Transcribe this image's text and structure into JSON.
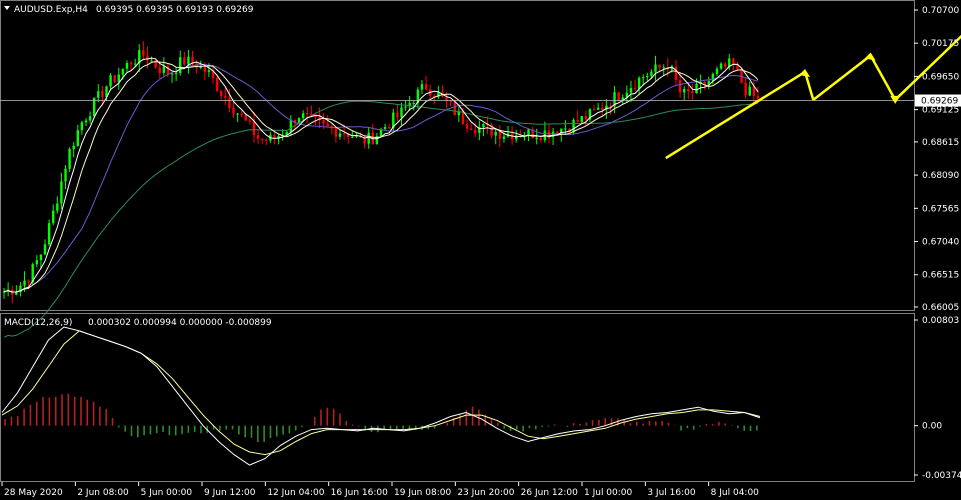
{
  "header": {
    "symbol": "AUDUSD.Exp,H4",
    "ohlc": "0.69395 0.69395 0.69193 0.69269"
  },
  "macd_header": {
    "label": "MACD(12,26,9)",
    "values": "0.000302 0.000994 0.000000 -0.000899"
  },
  "colors": {
    "background": "#000000",
    "bull_candle": "#00ff00",
    "bear_candle": "#ff0000",
    "ma_fast": "#ffffff",
    "ma_mid": "#fffacd",
    "ma_slow": "#6a5acd",
    "ma_long": "#2e8b57",
    "arrows": "#ffff00",
    "macd_line": "#ffffff",
    "signal_line": "#ffff99",
    "hist_pos": "#b22222",
    "hist_neg": "#2e8b2e",
    "price_line": "#c0c0c0"
  },
  "chart_data": [
    {
      "type": "candlestick",
      "title": "AUDUSD.Exp,H4",
      "ylim": [
        0.66005,
        0.707
      ],
      "y_ticks": [
        "0.70700",
        "0.70175",
        "0.69650",
        "0.69125",
        "0.68615",
        "0.68090",
        "0.67565",
        "0.67040",
        "0.66515",
        "0.66005"
      ],
      "current_price": "0.69269",
      "x_ticks": [
        "28 May 2020",
        "2 Jun 08:00",
        "5 Jun 00:00",
        "9 Jun 12:00",
        "12 Jun 04:00",
        "16 Jun 16:00",
        "19 Jun 08:00",
        "23 Jun 20:00",
        "26 Jun 12:00",
        "1 Jul 00:00",
        "3 Jul 16:00",
        "8 Jul 04:00"
      ],
      "trend_points": [
        0.6625,
        0.663,
        0.665,
        0.669,
        0.676,
        0.684,
        0.689,
        0.692,
        0.695,
        0.697,
        0.699,
        0.7,
        0.698,
        0.697,
        0.699,
        0.6985,
        0.697,
        0.694,
        0.6915,
        0.689,
        0.6865,
        0.6865,
        0.688,
        0.6905,
        0.6895,
        0.6885,
        0.688,
        0.6875,
        0.6862,
        0.687,
        0.689,
        0.6905,
        0.693,
        0.695,
        0.6935,
        0.6915,
        0.6895,
        0.6885,
        0.688,
        0.6875,
        0.6875,
        0.6875,
        0.6875,
        0.688,
        0.6885,
        0.6895,
        0.6905,
        0.692,
        0.6935,
        0.695,
        0.6965,
        0.6975,
        0.6985,
        0.6935,
        0.694,
        0.6955,
        0.6975,
        0.6985,
        0.6945,
        0.6927
      ]
    },
    {
      "type": "macd",
      "title": "MACD(12,26,9)",
      "ylim": [
        -0.003749,
        0.00803
      ],
      "y_ticks": [
        "0.00803",
        "0.00",
        "-0.003749"
      ],
      "histogram": [
        0.0005,
        0.0008,
        0.0016,
        0.0022,
        0.0023,
        0.0024,
        0.0021,
        0.0017,
        0.0012,
        -0.0003,
        -0.0009,
        -0.0008,
        -0.0006,
        -0.0006,
        -0.0007,
        -0.0006,
        -0.0004,
        -0.0003,
        -0.0004,
        -0.0009,
        -0.0012,
        -0.001,
        -0.0007,
        -0.0003,
        0.0002,
        0.0016,
        0.0011,
        0.0003,
        -0.0002,
        -0.0005,
        -0.0004,
        -0.0003,
        -0.0003,
        -0.0002,
        -0.0001,
        0.0004,
        0.0012,
        0.0014,
        0.0006,
        -0.0001,
        -0.0004,
        -0.0003,
        -0.0001,
        0.0001,
        -0.0001,
        0.0002,
        0.0004,
        0.0005,
        0.0005,
        0.0003,
        0.0002,
        0.0003,
        0.0002,
        -0.0003,
        -0.0002,
        0.0001,
        0.0002,
        0.0001,
        -0.0003,
        -0.0004
      ],
      "macd": [
        0.001,
        0.0025,
        0.0045,
        0.0065,
        0.0075,
        0.0072,
        0.0068,
        0.0064,
        0.006,
        0.0055,
        0.0045,
        0.003,
        0.0015,
        0.0,
        -0.0012,
        -0.0022,
        -0.003,
        -0.0025,
        -0.0015,
        -0.0008,
        -0.0003,
        -0.0002,
        -0.0003,
        -0.0004,
        -0.0002,
        -0.0003,
        -0.0004,
        -0.0002,
        0.0002,
        0.0007,
        0.001,
        0.0005,
        -0.0002,
        -0.0008,
        -0.0012,
        -0.0009,
        -0.0006,
        -0.0004,
        -0.0003,
        0.0,
        0.0004,
        0.0007,
        0.0009,
        0.001,
        0.0012,
        0.0014,
        0.0011,
        0.0009,
        0.001,
        0.0006
      ],
      "signal": [
        0.0008,
        0.0015,
        0.0028,
        0.0045,
        0.0062,
        0.0072,
        0.0068,
        0.0064,
        0.006,
        0.0055,
        0.0047,
        0.0036,
        0.0022,
        0.0008,
        -0.0004,
        -0.0014,
        -0.002,
        -0.0022,
        -0.0019,
        -0.0012,
        -0.0006,
        -0.0003,
        -0.0003,
        -0.0003,
        -0.0003,
        -0.0003,
        -0.0003,
        -0.0002,
        0.0,
        0.0004,
        0.0008,
        0.0008,
        0.0004,
        -0.0002,
        -0.0008,
        -0.001,
        -0.0008,
        -0.0006,
        -0.0004,
        -0.0002,
        0.0002,
        0.0005,
        0.0007,
        0.0009,
        0.001,
        0.0012,
        0.0012,
        0.0011,
        0.001,
        0.0007
      ]
    }
  ]
}
